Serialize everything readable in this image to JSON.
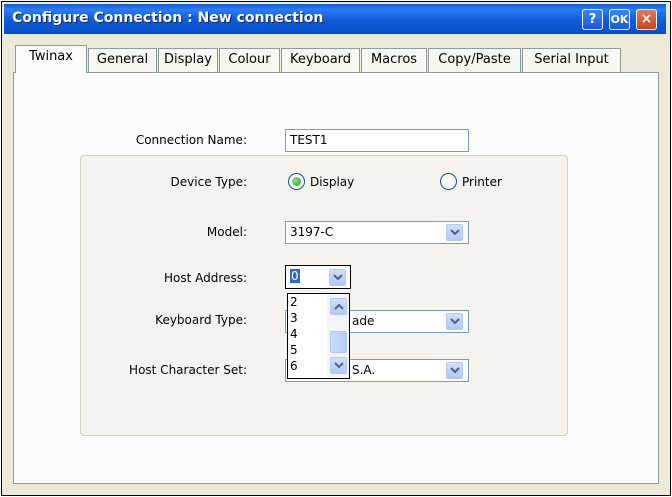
{
  "window": {
    "title": "Configure Connection : New connection",
    "help_label": "?",
    "ok_label": "OK",
    "close_label": "×"
  },
  "tabs": [
    "Twinax",
    "General",
    "Display",
    "Colour",
    "Keyboard",
    "Macros",
    "Copy/Paste",
    "Serial Input"
  ],
  "form": {
    "connection_name_label": "Connection Name:",
    "connection_name_value": "TEST1",
    "device_type_label": "Device Type:",
    "device_options": [
      "Display",
      "Printer"
    ],
    "device_selected": "Display",
    "model_label": "Model:",
    "model_value": "3197-C",
    "host_address_label": "Host Address:",
    "host_address_value": "0",
    "host_address_options": [
      "2",
      "3",
      "4",
      "5",
      "6"
    ],
    "keyboard_type_label": "Keyboard Type:",
    "keyboard_type_value_visible": "ade",
    "host_charset_label": "Host Character Set:",
    "host_charset_value_visible": "S.A."
  },
  "colors": {
    "titlebar": "#0a5fe0",
    "accent_radio": "#21a121"
  }
}
